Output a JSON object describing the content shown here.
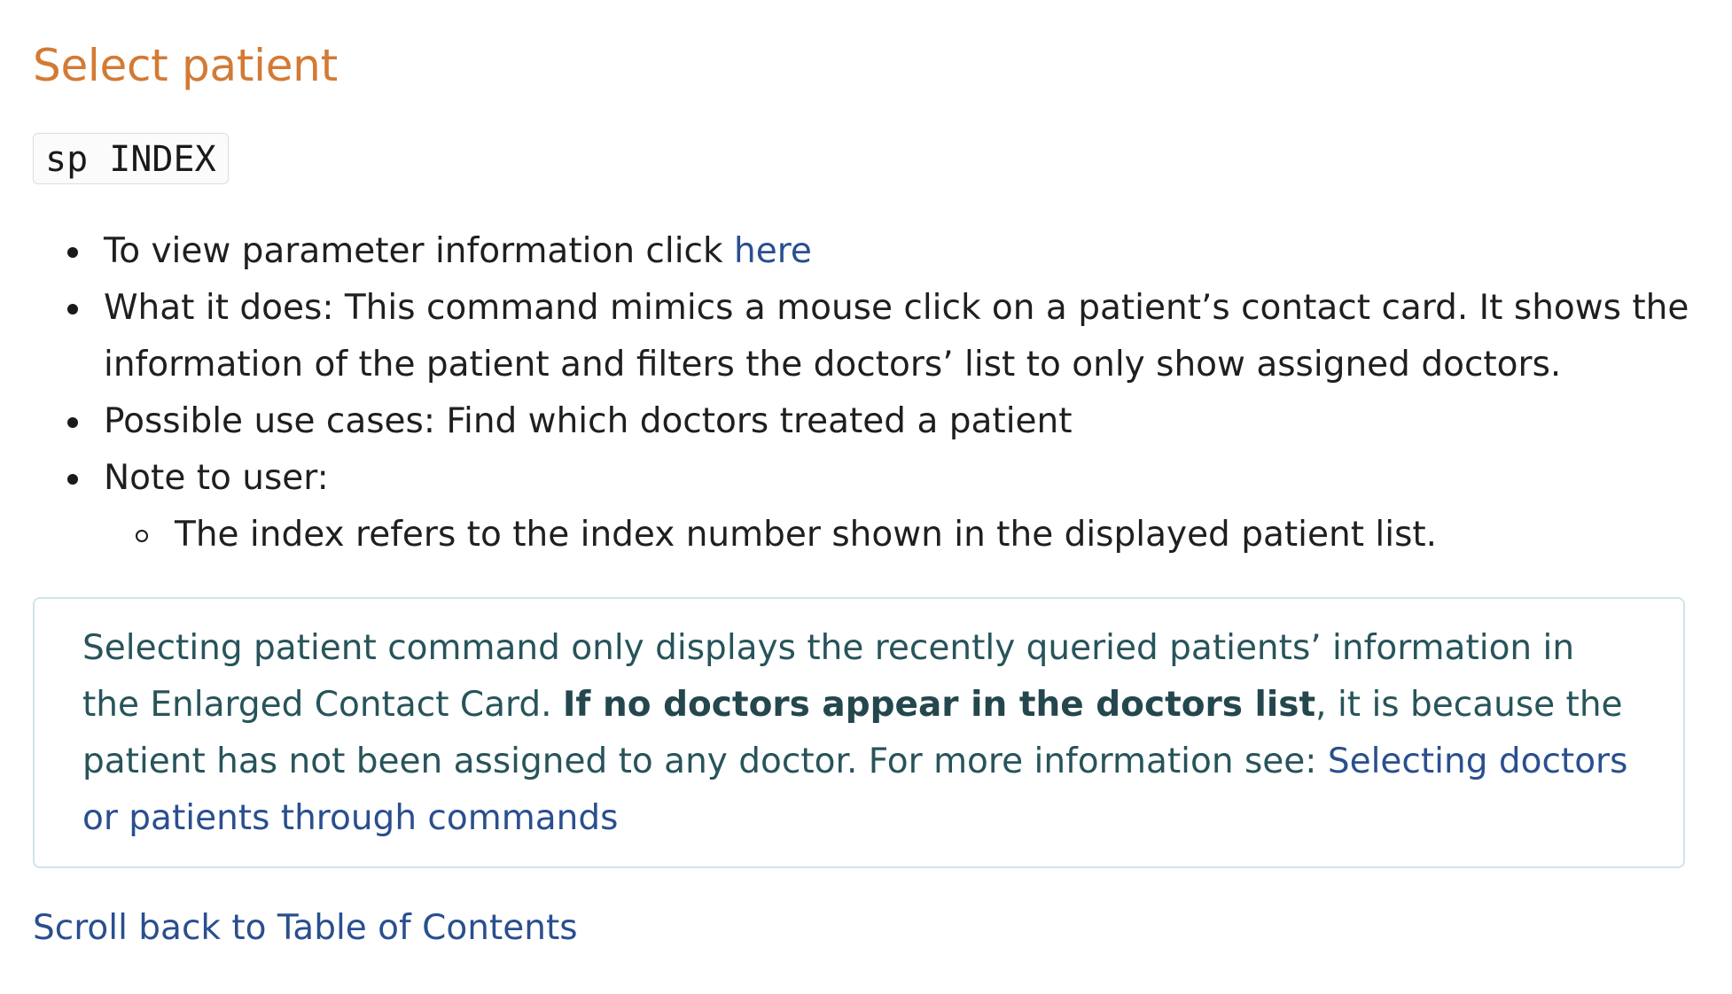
{
  "section": {
    "title": "Select patient",
    "command_syntax": "sp INDEX"
  },
  "bullets": {
    "param_info_text": "To view parameter information click ",
    "param_info_link": "here",
    "what_it_does": "What it does: This command mimics a mouse click on a patient’s contact card. It shows the information of the patient and filters the doctors’ list to only show assigned doctors.",
    "use_cases": "Possible use cases: Find which doctors treated a patient",
    "note_label": "Note to user:",
    "note_items": [
      "The index refers to the index number shown in the displayed patient list."
    ]
  },
  "callout": {
    "text_1": "Selecting patient command only displays the recently queried patients’ information in the Enlarged Contact Card. ",
    "bold_text": "If no doctors appear in the doctors list",
    "text_2": ", it is because the patient has not been assigned to any doctor. For more information see: ",
    "link_text": "Selecting doctors or patients through commands"
  },
  "footer": {
    "toc_link": "Scroll back to Table of Contents"
  },
  "colors": {
    "heading": "#d37a34",
    "link": "#2a4f8f",
    "callout_text": "#27545a",
    "callout_border": "#cfe6ea"
  }
}
